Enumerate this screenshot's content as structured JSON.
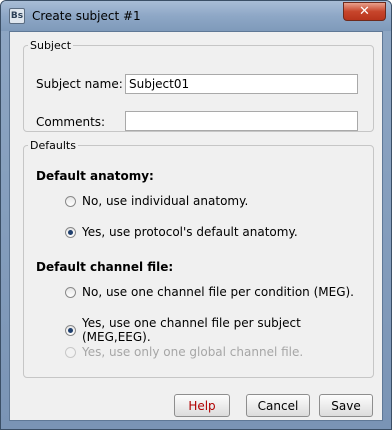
{
  "window": {
    "title": "Create subject #1",
    "app_icon": "Bs",
    "close_symbol": "✕"
  },
  "subject": {
    "legend": "Subject",
    "name_label": "Subject name:",
    "name_value": "Subject01",
    "comments_label": "Comments:",
    "comments_value": ""
  },
  "defaults": {
    "legend": "Defaults",
    "anatomy": {
      "title": "Default anatomy:",
      "options": [
        {
          "label": "No, use individual anatomy.",
          "checked": false,
          "enabled": true
        },
        {
          "label": "Yes, use protocol's default anatomy.",
          "checked": true,
          "enabled": true
        }
      ]
    },
    "channel": {
      "title": "Default channel file:",
      "options": [
        {
          "label": "No, use one channel file per condition (MEG).",
          "checked": false,
          "enabled": true
        },
        {
          "label": "Yes, use one channel file per subject (MEG,EEG).",
          "checked": true,
          "enabled": true
        },
        {
          "label": "Yes, use only one global channel file.",
          "checked": false,
          "enabled": false
        }
      ]
    }
  },
  "buttons": {
    "help": "Help",
    "cancel": "Cancel",
    "save": "Save"
  }
}
